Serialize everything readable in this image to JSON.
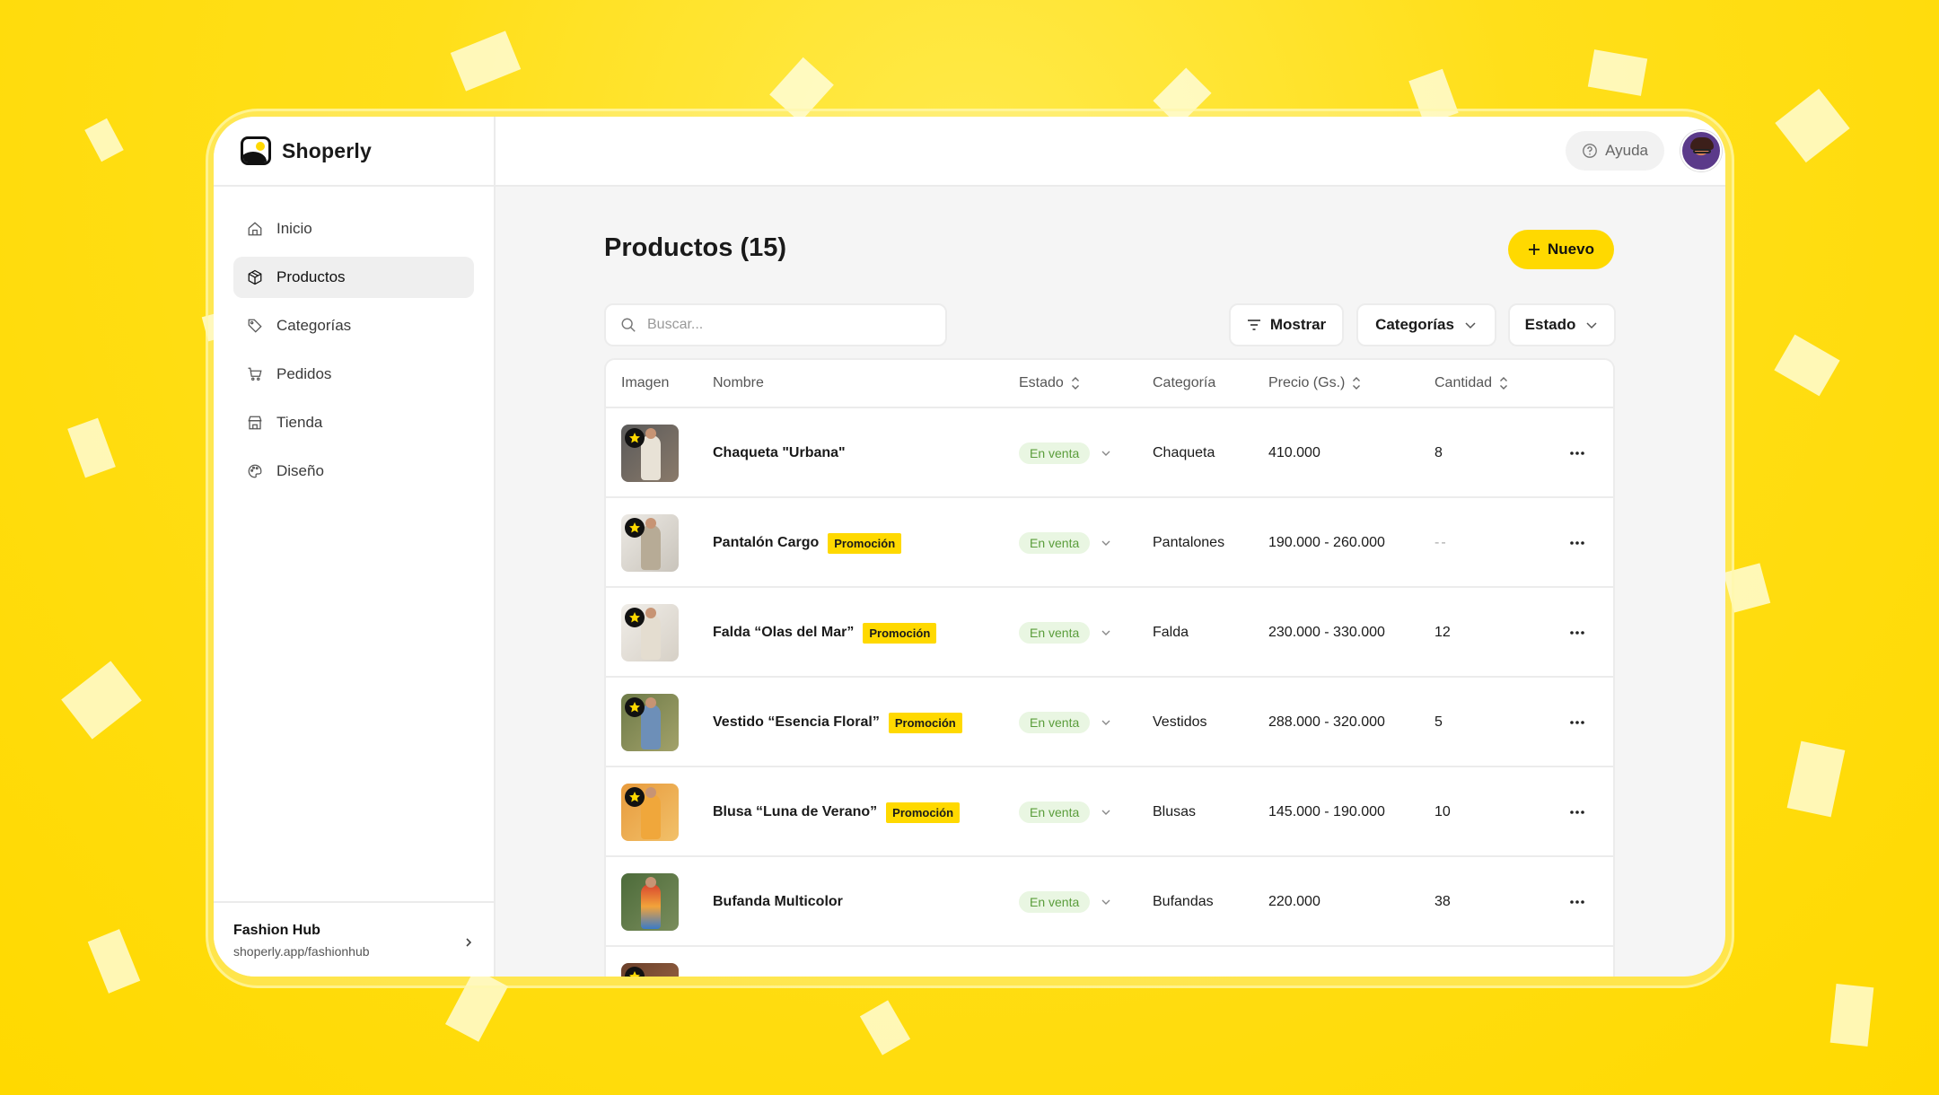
{
  "app": {
    "name": "Shoperly"
  },
  "sidebar": {
    "items": [
      {
        "label": "Inicio",
        "icon": "home-icon"
      },
      {
        "label": "Productos",
        "icon": "box-icon"
      },
      {
        "label": "Categorías",
        "icon": "tag-icon"
      },
      {
        "label": "Pedidos",
        "icon": "cart-icon"
      },
      {
        "label": "Tienda",
        "icon": "store-icon"
      },
      {
        "label": "Diseño",
        "icon": "palette-icon"
      }
    ],
    "active": "Productos",
    "store": {
      "name": "Fashion Hub",
      "url": "shoperly.app/fashionhub"
    }
  },
  "topbar": {
    "help_label": "Ayuda"
  },
  "main": {
    "title": "Productos (15)",
    "new_button": "Nuevo",
    "search_placeholder": "Buscar...",
    "filters": {
      "show": "Mostrar",
      "categories": "Categorías",
      "status": "Estado"
    }
  },
  "table": {
    "headers": {
      "image": "Imagen",
      "name": "Nombre",
      "status": "Estado",
      "category": "Categoría",
      "price": "Precio (Gs.)",
      "quantity": "Cantidad"
    },
    "rows": [
      {
        "name": "Chaqueta \"Urbana\"",
        "promo": "",
        "status": "En venta",
        "category": "Chaqueta",
        "price": "410.000",
        "quantity": "8"
      },
      {
        "name": "Pantalón Cargo",
        "promo": "Promoción",
        "status": "En venta",
        "category": "Pantalones",
        "price": "190.000 - 260.000",
        "quantity": "--"
      },
      {
        "name": "Falda “Olas del Mar”",
        "promo": "Promoción",
        "status": "En venta",
        "category": "Falda",
        "price": "230.000 - 330.000",
        "quantity": "12"
      },
      {
        "name": "Vestido “Esencia Floral”",
        "promo": "Promoción",
        "status": "En venta",
        "category": "Vestidos",
        "price": "288.000 - 320.000",
        "quantity": "5"
      },
      {
        "name": "Blusa “Luna de Verano”",
        "promo": "Promoción",
        "status": "En venta",
        "category": "Blusas",
        "price": "145.000 - 190.000",
        "quantity": "10"
      },
      {
        "name": "Bufanda Multicolor",
        "promo": "",
        "status": "En venta",
        "category": "Bufandas",
        "price": "220.000",
        "quantity": "38"
      }
    ]
  },
  "colors": {
    "brand": "#ffd900",
    "status_bg": "#e9f6e2",
    "status_text": "#5a9d3b"
  }
}
